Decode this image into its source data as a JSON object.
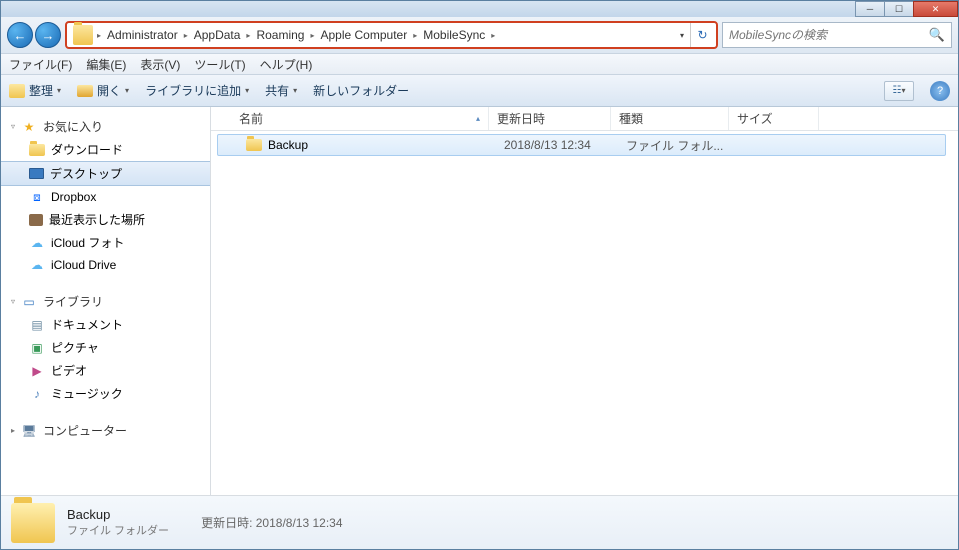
{
  "window": {
    "buttons": {
      "min": "─",
      "max": "☐",
      "close": "✕"
    }
  },
  "nav": {
    "back": "←",
    "fwd": "→",
    "crumbs": [
      "Administrator",
      "AppData",
      "Roaming",
      "Apple Computer",
      "MobileSync"
    ],
    "sep": "▸",
    "dropdown": "▾",
    "refresh": "↻"
  },
  "search": {
    "placeholder": "MobileSyncの検索",
    "icon": "🔍"
  },
  "menu": [
    "ファイル(F)",
    "編集(E)",
    "表示(V)",
    "ツール(T)",
    "ヘルプ(H)"
  ],
  "toolbar": {
    "organize": "整理",
    "open": "開く",
    "addlib": "ライブラリに追加",
    "share": "共有",
    "newfolder": "新しいフォルダー",
    "view": "☷",
    "help": "?"
  },
  "sidebar": {
    "favorites": {
      "label": "お気に入り",
      "exp": "▿",
      "items": [
        {
          "icon": "download",
          "label": "ダウンロード"
        },
        {
          "icon": "desktop",
          "label": "デスクトップ",
          "selected": true
        },
        {
          "icon": "dropbox",
          "label": "Dropbox"
        },
        {
          "icon": "recent",
          "label": "最近表示した場所"
        },
        {
          "icon": "cloudphoto",
          "label": "iCloud フォト"
        },
        {
          "icon": "clouddrive",
          "label": "iCloud Drive"
        }
      ]
    },
    "libraries": {
      "label": "ライブラリ",
      "exp": "▿",
      "items": [
        {
          "icon": "doc",
          "label": "ドキュメント"
        },
        {
          "icon": "pic",
          "label": "ピクチャ"
        },
        {
          "icon": "vid",
          "label": "ビデオ"
        },
        {
          "icon": "music",
          "label": "ミュージック"
        }
      ]
    },
    "computer": {
      "label": "コンピューター",
      "exp": "▸"
    }
  },
  "columns": {
    "name": "名前",
    "date": "更新日時",
    "type": "種類",
    "size": "サイズ",
    "sort": "▴"
  },
  "files": [
    {
      "name": "Backup",
      "date": "2018/8/13 12:34",
      "type": "ファイル フォル..."
    }
  ],
  "details": {
    "name": "Backup",
    "type": "ファイル フォルダー",
    "meta_label": "更新日時:",
    "meta_value": "2018/8/13 12:34"
  }
}
